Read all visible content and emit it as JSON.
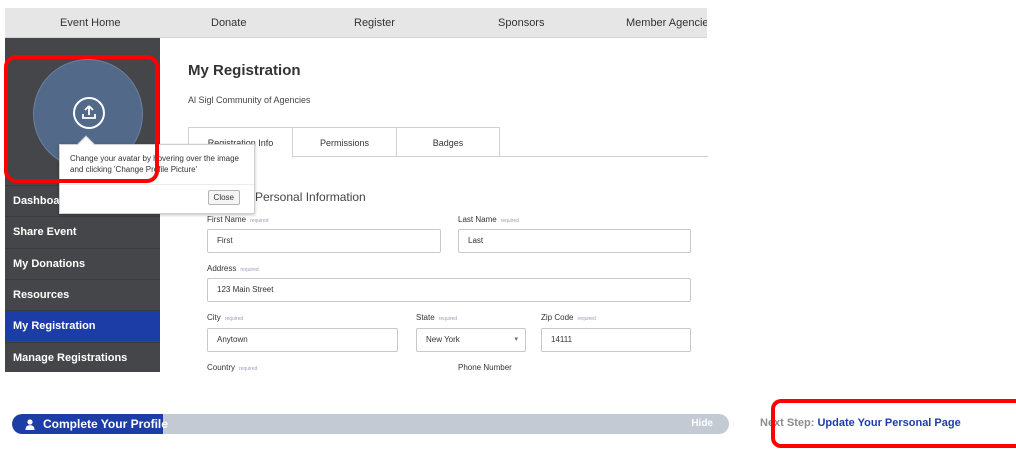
{
  "topnav": {
    "items": [
      "Event Home",
      "Donate",
      "Register",
      "Sponsors",
      "Member Agencies"
    ]
  },
  "sidebar": {
    "items": [
      {
        "label": "Dashboard",
        "active": false
      },
      {
        "label": "Share Event",
        "active": false
      },
      {
        "label": "My Donations",
        "active": false
      },
      {
        "label": "Resources",
        "active": false
      },
      {
        "label": "My Registration",
        "active": true
      },
      {
        "label": "Manage Registrations",
        "active": false
      }
    ]
  },
  "tooltip": {
    "text": "Change your avatar by hovering over the image and clicking 'Change Profile Picture'",
    "close_label": "Close"
  },
  "main": {
    "title": "My Registration",
    "subtitle": "Al Sigl Community of Agencies",
    "tabs": [
      {
        "label": "Registration Info",
        "active": true
      },
      {
        "label": "Permissions",
        "active": false
      },
      {
        "label": "Badges",
        "active": false
      }
    ],
    "section_title": "Personal Information",
    "required_text": "required",
    "fields": {
      "first_name": {
        "label": "First Name",
        "value": "First"
      },
      "last_name": {
        "label": "Last Name",
        "value": "Last"
      },
      "address": {
        "label": "Address",
        "value": "123 Main Street"
      },
      "city": {
        "label": "City",
        "value": "Anytown"
      },
      "state": {
        "label": "State",
        "value": "New York"
      },
      "zip": {
        "label": "Zip Code",
        "value": "14111"
      },
      "country": {
        "label": "Country"
      },
      "phone": {
        "label": "Phone Number"
      }
    }
  },
  "progress": {
    "label": "Complete Your Profile",
    "hide_label": "Hide",
    "fill_fraction": 0.21
  },
  "next_step": {
    "prefix": "Next Step:",
    "link": "Update Your Personal Page"
  },
  "colors": {
    "accent": "#1d3da6",
    "sidebar_bg": "#444649",
    "highlight": "#ff0000"
  }
}
